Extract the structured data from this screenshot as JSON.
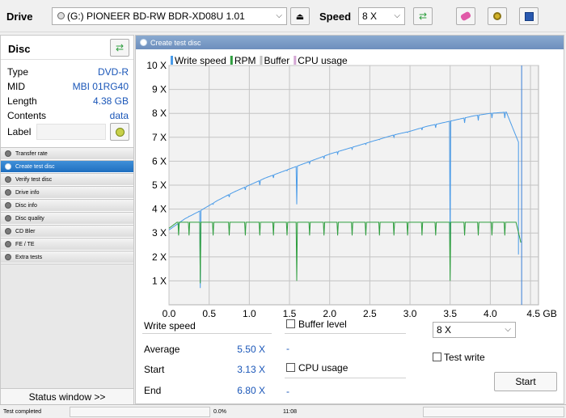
{
  "topbar": {
    "drive_label": "Drive",
    "drive_value": "(G:)   PIONEER BD-RW   BDR-XD08U 1.01",
    "speed_label": "Speed",
    "speed_value": "8 X"
  },
  "disc": {
    "title": "Disc",
    "rows": [
      {
        "key": "Type",
        "value": "DVD-R"
      },
      {
        "key": "MID",
        "value": "MBI 01RG40"
      },
      {
        "key": "Length",
        "value": "4.38 GB"
      },
      {
        "key": "Contents",
        "value": "data"
      },
      {
        "key": "Label",
        "value": ""
      }
    ]
  },
  "nav": {
    "items": [
      {
        "label": "Transfer rate",
        "active": false
      },
      {
        "label": "Create test disc",
        "active": true
      },
      {
        "label": "Verify test disc",
        "active": false
      },
      {
        "label": "Drive info",
        "active": false
      },
      {
        "label": "Disc info",
        "active": false
      },
      {
        "label": "Disc quality",
        "active": false
      },
      {
        "label": "CD Bler",
        "active": false
      },
      {
        "label": "FE / TE",
        "active": false
      },
      {
        "label": "Extra tests",
        "active": false
      }
    ],
    "status_window": "Status window >>"
  },
  "panel": {
    "title": "Create test disc"
  },
  "chart_data": {
    "type": "line",
    "legend": [
      "Write speed",
      "RPM",
      "Buffer",
      "CPU usage"
    ],
    "legend_colors": [
      "#4a9be8",
      "#2e9e3e",
      "#c0c0c0",
      "#d4a6d4"
    ],
    "x_ticks": [
      "0.0",
      "0.5",
      "1.0",
      "1.5",
      "2.0",
      "2.5",
      "3.0",
      "3.5",
      "4.0",
      "4.5 GB"
    ],
    "y_ticks": [
      "1 X",
      "2 X",
      "3 X",
      "4 X",
      "5 X",
      "6 X",
      "7 X",
      "8 X",
      "9 X",
      "10 X"
    ],
    "xlim": [
      0,
      4.6
    ],
    "ylim": [
      0,
      10
    ],
    "end_marker_x": 4.38,
    "series": [
      {
        "name": "Write speed",
        "x": [
          0.0,
          0.2,
          0.4,
          0.6,
          0.8,
          1.0,
          1.2,
          1.4,
          1.6,
          1.8,
          2.0,
          2.2,
          2.4,
          2.6,
          2.8,
          3.0,
          3.2,
          3.4,
          3.6,
          3.8,
          4.0,
          4.2,
          4.35
        ],
        "values": [
          3.13,
          3.6,
          3.95,
          4.35,
          4.7,
          5.0,
          5.3,
          5.55,
          5.8,
          6.05,
          6.3,
          6.5,
          6.7,
          6.9,
          7.1,
          7.25,
          7.45,
          7.6,
          7.75,
          7.9,
          8.0,
          8.05,
          6.8
        ],
        "dips_x": [
          0.12,
          0.25,
          0.39,
          0.55,
          0.75,
          0.95,
          1.13,
          1.3,
          1.47,
          1.59,
          1.75,
          1.93,
          2.1,
          2.28,
          2.45,
          2.62,
          2.8,
          2.97,
          3.15,
          3.32,
          3.5,
          3.68,
          3.85,
          4.02,
          4.18
        ],
        "dips_to": [
          3.3,
          3.7,
          0.7,
          4.2,
          4.5,
          4.8,
          5.0,
          5.3,
          5.6,
          4.2,
          5.9,
          6.1,
          6.3,
          6.5,
          6.7,
          6.9,
          7.0,
          7.2,
          7.3,
          7.4,
          2.5,
          7.6,
          7.7,
          7.8,
          7.8
        ]
      },
      {
        "name": "RPM",
        "x": [
          0.0,
          0.1,
          4.32,
          4.38
        ],
        "values": [
          3.2,
          3.45,
          3.45,
          2.6
        ],
        "dips_x": [
          0.12,
          0.25,
          0.39,
          0.55,
          0.75,
          0.95,
          1.13,
          1.3,
          1.47,
          1.59,
          1.75,
          1.93,
          2.1,
          2.28,
          2.45,
          2.62,
          2.8,
          2.97,
          3.15,
          3.32,
          3.5,
          3.68,
          3.85,
          4.02,
          4.18
        ],
        "dips_to": [
          2.9,
          2.9,
          0.9,
          2.9,
          2.9,
          2.9,
          2.9,
          2.9,
          2.9,
          1.0,
          2.9,
          2.9,
          2.9,
          2.9,
          2.9,
          2.9,
          2.9,
          2.9,
          2.9,
          2.9,
          1.0,
          2.9,
          2.9,
          2.9,
          2.9
        ]
      }
    ]
  },
  "stats": {
    "write_speed_title": "Write speed",
    "average_label": "Average",
    "average_value": "5.50 X",
    "start_label": "Start",
    "start_value": "3.13 X",
    "end_label": "End",
    "end_value": "6.80 X",
    "buffer_level_label": "Buffer level",
    "buffer_value": "-",
    "cpu_usage_label": "CPU usage",
    "cpu_value": "-",
    "speed_select": "8 X",
    "test_write_label": "Test write",
    "start_button": "Start"
  },
  "statusbar": {
    "text": "Test completed",
    "percent": "0.0%",
    "time": "11:08"
  }
}
